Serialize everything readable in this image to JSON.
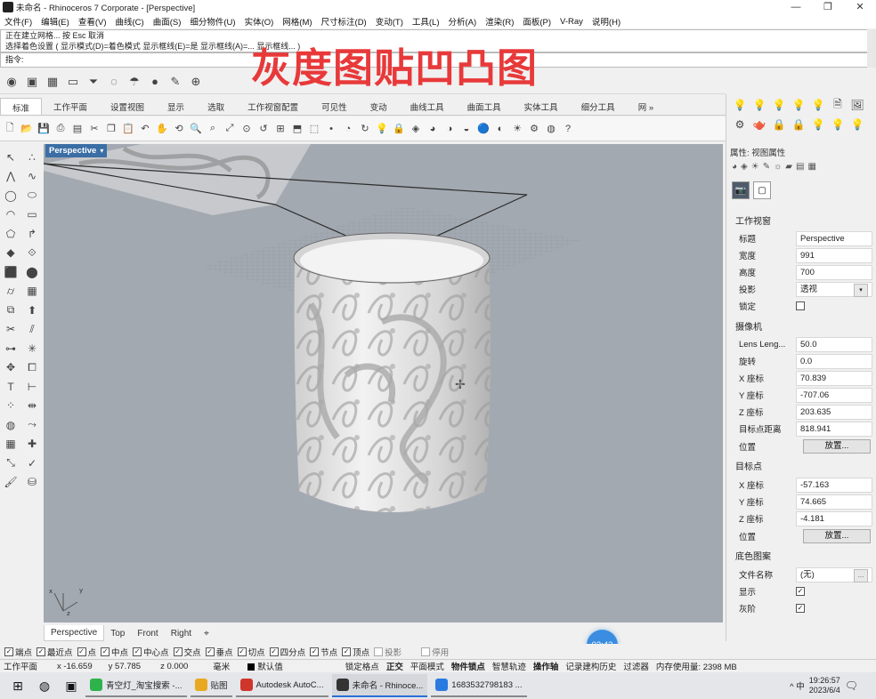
{
  "window": {
    "title": "未命名 - Rhinoceros 7 Corporate - [Perspective]",
    "controls": [
      "—",
      "❐",
      "✕"
    ]
  },
  "menu": [
    "文件(F)",
    "编辑(E)",
    "查看(V)",
    "曲线(C)",
    "曲面(S)",
    "细分物件(U)",
    "实体(O)",
    "网格(M)",
    "尺寸标注(D)",
    "变动(T)",
    "工具(L)",
    "分析(A)",
    "渲染(R)",
    "面板(P)",
    "V-Ray",
    "说明(H)"
  ],
  "command": {
    "history": [
      "正在建立网格... 按 Esc 取消",
      "选择着色设置 ( 显示模式(D)=着色模式  显示框线(E)=是  显示框线(A)=...  显示框线... )"
    ],
    "prompt": "指令:"
  },
  "overlay_title": "灰度图贴凹凸图",
  "toolbar_tabs": [
    "标准",
    "工作平面",
    "设置视图",
    "显示",
    "选取",
    "工作视窗配置",
    "可见性",
    "变动",
    "曲线工具",
    "曲面工具",
    "实体工具",
    "细分工具",
    "网 »"
  ],
  "viewport": {
    "title": "Perspective",
    "axis_labels": {
      "x": "x",
      "y": "y",
      "z": "z"
    }
  },
  "viewport_tabs": [
    "Perspective",
    "Top",
    "Front",
    "Right",
    "⌖"
  ],
  "timer": "02:43",
  "osnaps": [
    {
      "label": "端点",
      "checked": true
    },
    {
      "label": "最近点",
      "checked": true
    },
    {
      "label": "点",
      "checked": true
    },
    {
      "label": "中点",
      "checked": true
    },
    {
      "label": "中心点",
      "checked": true
    },
    {
      "label": "交点",
      "checked": true
    },
    {
      "label": "垂点",
      "checked": true
    },
    {
      "label": "切点",
      "checked": true
    },
    {
      "label": "四分点",
      "checked": true
    },
    {
      "label": "节点",
      "checked": true
    },
    {
      "label": "顶点",
      "checked": true
    },
    {
      "label": "投影",
      "checked": false
    },
    {
      "label": "停用",
      "checked": false
    }
  ],
  "status": {
    "cplane": "工作平面",
    "x": "x -16.659",
    "y": "y 57.785",
    "z": "z 0.000",
    "unit": "毫米",
    "layer": "默认值",
    "items": [
      "锁定格点",
      "正交",
      "平面模式",
      "物件锁点",
      "智慧轨迹",
      "操作轴",
      "记录建构历史",
      "过滤器",
      "内存使用量: 2398 MB"
    ]
  },
  "properties": {
    "header": "属性: 视图属性",
    "section_viewport": "工作视窗",
    "section_camera": "摄像机",
    "section_target": "目标点",
    "section_wallpaper": "底色图案",
    "title_label": "标题",
    "title_value": "Perspective",
    "width_label": "宽度",
    "width_value": "991",
    "height_label": "高度",
    "height_value": "700",
    "proj_label": "投影",
    "proj_value": "透视",
    "lock_label": "锁定",
    "lens_label": "Lens Leng...",
    "lens_value": "50.0",
    "rot_label": "旋转",
    "rot_value": "0.0",
    "cx_label": "X 座标",
    "cx_value": "70.839",
    "cy_label": "Y 座标",
    "cy_value": "-707.06",
    "cz_label": "Z 座标",
    "cz_value": "203.635",
    "dist_label": "目标点距离",
    "dist_value": "818.941",
    "pos_label": "位置",
    "place_button": "放置...",
    "tx_label": "X 座标",
    "tx_value": "-57.163",
    "ty_label": "Y 座标",
    "ty_value": "74.665",
    "tz_label": "Z 座标",
    "tz_value": "-4.181",
    "tpos_label": "位置",
    "tplace_button": "放置...",
    "file_label": "文件名称",
    "file_value": "(无)",
    "show_label": "显示",
    "gray_label": "灰阶"
  },
  "taskbar": {
    "apps": [
      {
        "label": "青空灯_淘宝搜索 -...",
        "color": "#2db34a"
      },
      {
        "label": "贴图",
        "color": "#e8a820"
      },
      {
        "label": "Autodesk AutoC...",
        "color": "#d0352b"
      },
      {
        "label": "未命名 - Rhinoce...",
        "color": "#333333"
      },
      {
        "label": "1683532798183 ...",
        "color": "#2a7ae2"
      }
    ],
    "tray": "^ 中",
    "time": "19:26:57",
    "date": "2023/6/4"
  },
  "colors": {
    "accent": "#3a6ea5",
    "overlay": "#e8393a",
    "viewport_bg": "#a3a9b1"
  }
}
